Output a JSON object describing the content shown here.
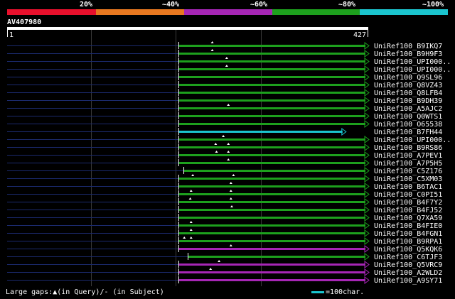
{
  "scale": {
    "labels": [
      "20%",
      "~40%",
      "~60%",
      "~80%",
      "~100%"
    ],
    "colors": [
      "#e8102c",
      "#e87820",
      "#a626b5",
      "#1da01d",
      "#1bc5cf"
    ]
  },
  "query": {
    "name": "AV407980",
    "start_label": "1",
    "end_label": "427"
  },
  "footer": {
    "gaps_text": "Large gaps:▲(in Query)/- (in Subject)",
    "legend_text": "=100char."
  },
  "chart_data": {
    "type": "alignment",
    "query_length": 427,
    "xlim": [
      1,
      427
    ],
    "gridlines": [
      100,
      200,
      300
    ],
    "colors": {
      "green": "#1da01d",
      "cyan": "#1bc5cf",
      "magenta": "#a626b5",
      "unaligned": "#1b2a6e"
    },
    "hits": [
      {
        "label": "UniRef100_B9IKQ7",
        "start": 203,
        "end": 427,
        "color": "green",
        "gaps": [
          243
        ]
      },
      {
        "label": "UniRef100_B9H9F3",
        "start": 203,
        "end": 427,
        "color": "green",
        "gaps": [
          243
        ]
      },
      {
        "label": "UniRef100_UPI000..",
        "start": 203,
        "end": 427,
        "color": "green",
        "gaps": [
          260
        ]
      },
      {
        "label": "UniRef100_UPI000..",
        "start": 203,
        "end": 427,
        "color": "green",
        "gaps": [
          260
        ]
      },
      {
        "label": "UniRef100_Q9SL96",
        "start": 203,
        "end": 427,
        "color": "green",
        "gaps": []
      },
      {
        "label": "UniRef100_Q8VZ43",
        "start": 203,
        "end": 427,
        "color": "green",
        "gaps": []
      },
      {
        "label": "UniRef100_Q8LFB4",
        "start": 203,
        "end": 427,
        "color": "green",
        "gaps": []
      },
      {
        "label": "UniRef100_B9DH39",
        "start": 203,
        "end": 427,
        "color": "green",
        "gaps": []
      },
      {
        "label": "UniRef100_A5AJC2",
        "start": 203,
        "end": 427,
        "color": "green",
        "gaps": [
          262
        ]
      },
      {
        "label": "UniRef100_Q0WTS1",
        "start": 203,
        "end": 427,
        "color": "green",
        "gaps": []
      },
      {
        "label": "UniRef100_O65538",
        "start": 203,
        "end": 427,
        "color": "green",
        "gaps": []
      },
      {
        "label": "UniRef100_B7FH44",
        "start": 203,
        "end": 400,
        "color": "cyan",
        "gaps": []
      },
      {
        "label": "UniRef100_UPI000..",
        "start": 203,
        "end": 427,
        "color": "green",
        "gaps": [
          256
        ]
      },
      {
        "label": "UniRef100_B9RS86",
        "start": 203,
        "end": 427,
        "color": "green",
        "gaps": [
          247,
          262
        ]
      },
      {
        "label": "UniRef100_A7PEV1",
        "start": 203,
        "end": 427,
        "color": "green",
        "gaps": [
          248,
          262
        ]
      },
      {
        "label": "UniRef100_A7P5H5",
        "start": 203,
        "end": 427,
        "color": "green",
        "gaps": [
          262
        ]
      },
      {
        "label": "UniRef100_C5Z176",
        "start": 209,
        "end": 427,
        "color": "green",
        "gaps": []
      },
      {
        "label": "UniRef100_C5XM03",
        "start": 203,
        "end": 427,
        "color": "green",
        "gaps": [
          220,
          268
        ]
      },
      {
        "label": "UniRef100_B6TAC1",
        "start": 203,
        "end": 427,
        "color": "green",
        "gaps": [
          265
        ]
      },
      {
        "label": "UniRef100_C0PI51",
        "start": 203,
        "end": 427,
        "color": "green",
        "gaps": [
          218,
          265
        ]
      },
      {
        "label": "UniRef100_B4F7Y2",
        "start": 203,
        "end": 427,
        "color": "green",
        "gaps": [
          217,
          265
        ]
      },
      {
        "label": "UniRef100_B4FJ52",
        "start": 203,
        "end": 427,
        "color": "green",
        "gaps": [
          266
        ]
      },
      {
        "label": "UniRef100_Q7XA59",
        "start": 203,
        "end": 427,
        "color": "green",
        "gaps": []
      },
      {
        "label": "UniRef100_B4FIE0",
        "start": 203,
        "end": 427,
        "color": "green",
        "gaps": [
          218
        ]
      },
      {
        "label": "UniRef100_B4FGN1",
        "start": 203,
        "end": 427,
        "color": "green",
        "gaps": [
          218
        ]
      },
      {
        "label": "UniRef100_B9RPA1",
        "start": 203,
        "end": 427,
        "color": "green",
        "gaps": [
          210,
          218
        ]
      },
      {
        "label": "UniRef100_Q5KQK6",
        "start": 203,
        "end": 427,
        "color": "magenta",
        "gaps": [
          265
        ]
      },
      {
        "label": "UniRef100_C6TJF3",
        "start": 214,
        "end": 427,
        "color": "green",
        "gaps": []
      },
      {
        "label": "UniRef100_Q5VRC9",
        "start": 203,
        "end": 427,
        "color": "magenta",
        "gaps": [
          251
        ]
      },
      {
        "label": "UniRef100_A2WLD2",
        "start": 203,
        "end": 427,
        "color": "magenta",
        "gaps": [
          241
        ]
      },
      {
        "label": "UniRef100_A9SY71",
        "start": 203,
        "end": 427,
        "color": "magenta",
        "gaps": []
      }
    ]
  }
}
